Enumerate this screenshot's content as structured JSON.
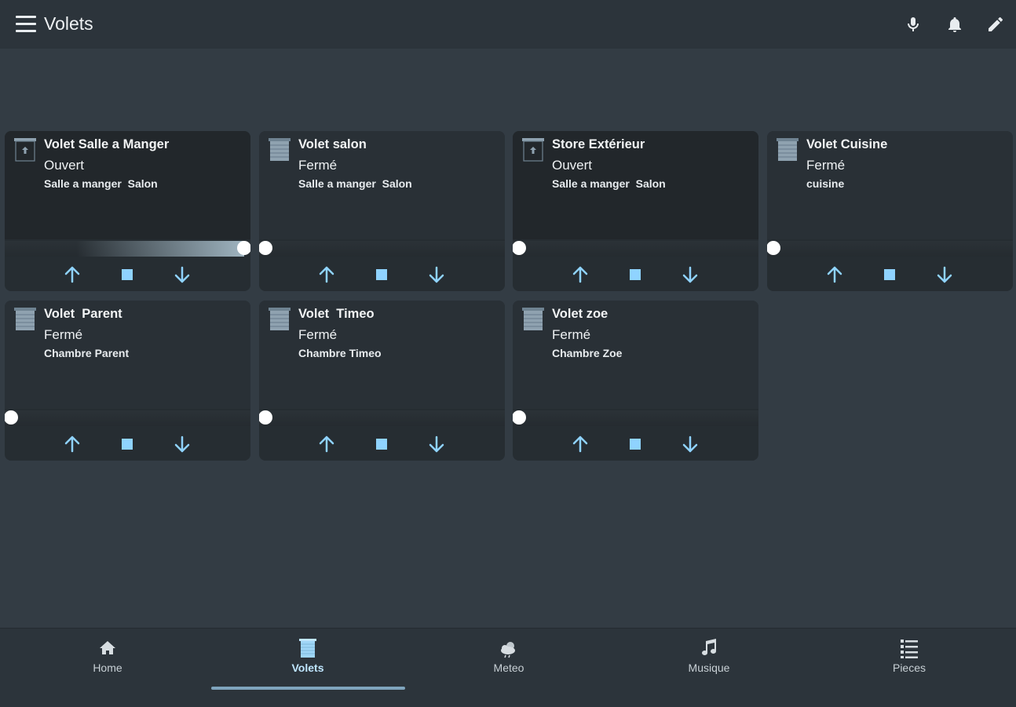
{
  "app": {
    "title": "Volets"
  },
  "colors": {
    "background": "#333c44",
    "card": "#262d32",
    "accent": "#8fd3ff",
    "nav_active": "#bfe6ff",
    "knob": "#ffffff"
  },
  "cards": [
    {
      "name": "Volet Salle a Manger",
      "state": "Ouvert",
      "room": "Salle a manger  Salon",
      "icon": "shutter-open-icon",
      "position": 100
    },
    {
      "name": "Volet salon",
      "state": "Fermé",
      "room": "Salle a manger  Salon",
      "icon": "shutter-closed-icon",
      "position": 0
    },
    {
      "name": "Store Extérieur",
      "state": "Ouvert",
      "room": "Salle a manger  Salon",
      "icon": "shutter-open-icon",
      "position": 0
    },
    {
      "name": "Volet Cuisine",
      "state": "Fermé",
      "room": "cuisine",
      "icon": "shutter-closed-icon",
      "position": 0
    },
    {
      "name": "Volet  Parent",
      "state": "Fermé",
      "room": "Chambre Parent",
      "icon": "shutter-closed-icon",
      "position": 0
    },
    {
      "name": "Volet  Timeo",
      "state": "Fermé",
      "room": "Chambre Timeo",
      "icon": "shutter-closed-icon",
      "position": 0
    },
    {
      "name": "Volet zoe",
      "state": "Fermé",
      "room": "Chambre Zoe",
      "icon": "shutter-closed-icon",
      "position": 0
    }
  ],
  "bottom_nav": [
    {
      "label": "Home",
      "icon": "home-icon",
      "active": false
    },
    {
      "label": "Volets",
      "icon": "blinds-icon",
      "active": true
    },
    {
      "label": "Meteo",
      "icon": "weather-icon",
      "active": false
    },
    {
      "label": "Musique",
      "icon": "music-note-icon",
      "active": false
    },
    {
      "label": "Pieces",
      "icon": "list-icon",
      "active": false
    }
  ]
}
